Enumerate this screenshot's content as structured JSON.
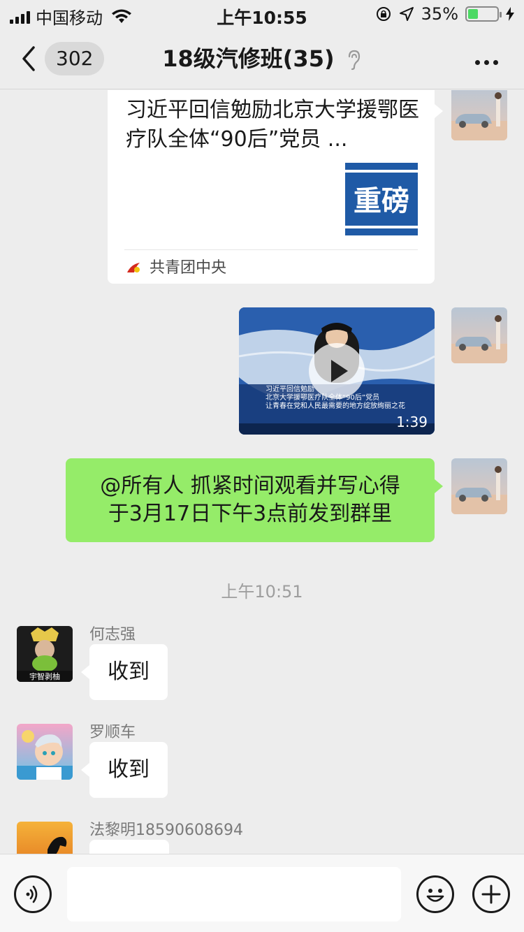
{
  "status_bar": {
    "carrier": "中国移动",
    "time": "上午10:55",
    "battery_text": "35%",
    "battery_level": 0.35
  },
  "nav": {
    "unread_count": "302",
    "title": "18级汽修班(35)"
  },
  "messages": {
    "card": {
      "title": "习近平回信勉励北京大学援鄂医疗队全体“90后”党员 ...",
      "thumb_text": "重磅",
      "source": "共青团中央"
    },
    "video": {
      "duration": "1:39",
      "caption_line1": "习近平回信勉励",
      "caption_line2": "北京大学援鄂医疗队全体“90后”党员",
      "caption_line3": "让青春在党和人民最需要的地方绽放绚丽之花"
    },
    "text_self": {
      "line1": "@所有人  抓紧时间观看并写心得",
      "line2": "于3月17日下午3点前发到群里"
    },
    "timestamp": "上午10:51",
    "reply1": {
      "sender": "何志强",
      "avatar_text": "宇智剥柚",
      "text": "收到"
    },
    "reply2": {
      "sender": "罗顺车",
      "text": "收到"
    },
    "reply3": {
      "sender": "法黎明18590608694"
    }
  },
  "input": {
    "placeholder": ""
  },
  "colors": {
    "self_bubble": "#95ec69",
    "background": "#ededed"
  }
}
